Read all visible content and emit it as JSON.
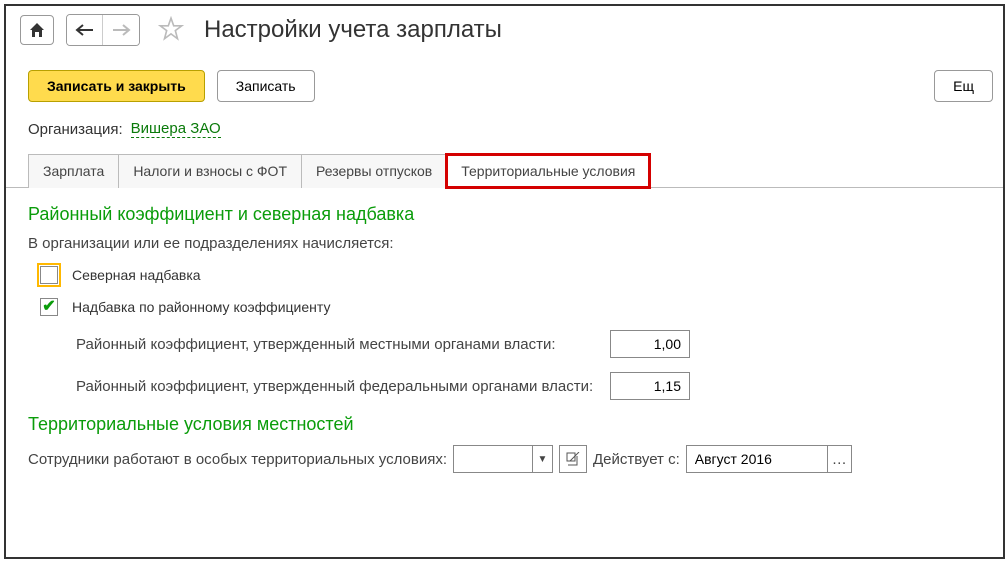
{
  "header": {
    "title": "Настройки учета зарплаты"
  },
  "actions": {
    "save_close": "Записать и закрыть",
    "save": "Записать",
    "more": "Ещ"
  },
  "organization": {
    "label": "Организация:",
    "value": "Вишера ЗАО"
  },
  "tabs": [
    {
      "label": "Зарплата"
    },
    {
      "label": "Налоги и взносы с ФОТ"
    },
    {
      "label": "Резервы отпусков"
    },
    {
      "label": "Территориальные условия"
    }
  ],
  "section1": {
    "title": "Районный коэффициент и северная надбавка",
    "subtitle": "В организации или ее подразделениях начисляется:",
    "check_north": "Северная надбавка",
    "check_district": "Надбавка по районному коэффициенту",
    "coef_local_label": "Районный коэффициент, утвержденный местными органами власти:",
    "coef_local_value": "1,00",
    "coef_federal_label": "Районный коэффициент, утвержденный федеральными органами власти:",
    "coef_federal_value": "1,15"
  },
  "section2": {
    "title": "Территориальные условия местностей",
    "row_label": "Сотрудники работают в особых территориальных условиях:",
    "combo_value": "",
    "effective_label": "Действует с:",
    "effective_value": "Август 2016"
  }
}
